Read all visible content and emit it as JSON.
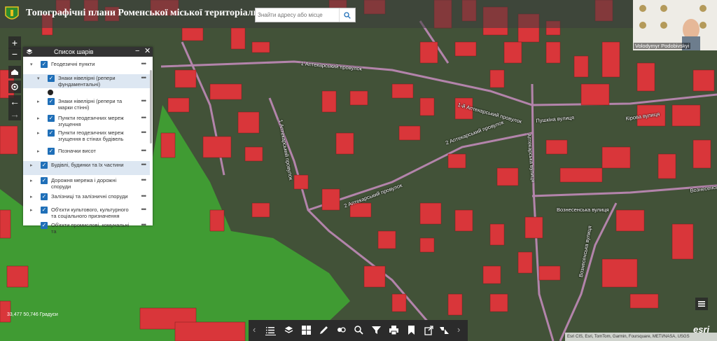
{
  "header": {
    "title": "Топографічні плани Роменської міської територіальної громади",
    "search_placeholder": "Знайти адресу або місце"
  },
  "nav": {
    "zoom_in": "+",
    "zoom_out": "−",
    "home": "home-icon",
    "locate": "locate-icon",
    "back": "←",
    "forward": "→"
  },
  "layer_panel": {
    "title": "Список шарів",
    "minimize": "−",
    "close": "✕",
    "more": "•••",
    "layers": [
      {
        "label": "Геодезичні пункти",
        "checked": true
      },
      {
        "label": "Знаки нівелірні (репери фундаментальні)",
        "checked": true
      },
      {
        "label": "Знаки нівелірні (репери та марки стінні)",
        "checked": true
      },
      {
        "label": "Пункти геодезичних мереж згущення",
        "checked": true
      },
      {
        "label": "Пункти геодезичних мереж згущення в стінах будівель",
        "checked": true
      },
      {
        "label": "Позначки висот",
        "checked": true
      },
      {
        "label": "Будівлі, будинки та їх частини",
        "checked": true
      },
      {
        "label": "Дорожня мережа і дорожні споруди",
        "checked": true
      },
      {
        "label": "Залізниці та залізничні споруди",
        "checked": true
      },
      {
        "label": "Об'єкти культового, культурного та соціального призначення",
        "checked": true
      },
      {
        "label": "Об'єкти промислові, комунальні та",
        "checked": true
      }
    ]
  },
  "map": {
    "streets": [
      "1 Аптекарський провулок",
      "1-й Аптекарський провулок",
      "2 Аптекарський провулок",
      "2 Аптекарський провулок",
      "Аптекарська вулиця",
      "Пушкіна вулиця",
      "Вознесенська вулиця",
      "Вознесенська вулиця",
      "Кірова вулиця",
      "Вознесенська вулиця",
      "1 Аптекарський провулок"
    ],
    "coordinates": "33,477 50,746 Градуси",
    "attribution": "Esri CIS, Esri, TomTom, Garmin, Foursquare, METI/NASA, USGS",
    "esri_logo": "esri",
    "colors": {
      "building": "#d9363a",
      "vegetation": "#3fa832",
      "road": "#c08ab8"
    }
  },
  "webcam": {
    "name": "Volodymyr Podobivskyi"
  },
  "toolbar": {
    "tools": [
      "layer-list-icon",
      "layers-icon",
      "basemap-gallery-icon",
      "draw-icon",
      "analysis-icon",
      "query-icon",
      "filter-icon",
      "print-icon",
      "bookmark-icon",
      "share-icon",
      "chart-icon"
    ],
    "prev": "‹",
    "next": "›"
  }
}
